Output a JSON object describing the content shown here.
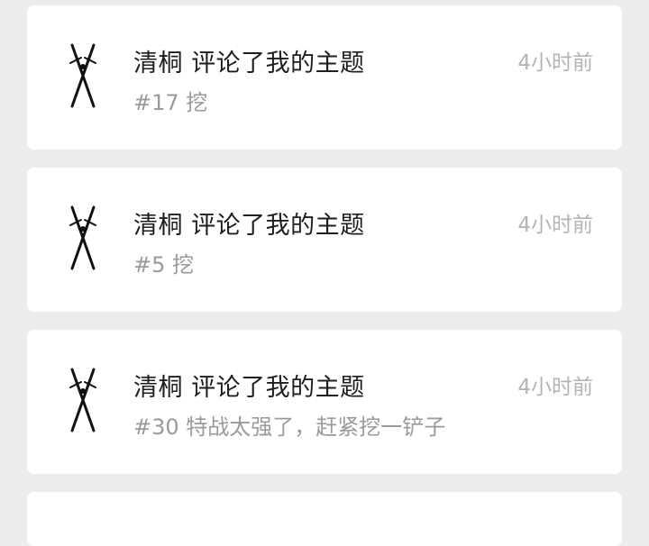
{
  "notifications": [
    {
      "user": "清桐",
      "action": "评论了我的主题",
      "snippet": "#17 挖",
      "time": "4小时前",
      "avatar_icon": "crossed-swords-icon"
    },
    {
      "user": "清桐",
      "action": "评论了我的主题",
      "snippet": "#5 挖",
      "time": "4小时前",
      "avatar_icon": "crossed-swords-icon"
    },
    {
      "user": "清桐",
      "action": "评论了我的主题",
      "snippet": "#30 特战太强了，赶紧挖一铲子",
      "time": "4小时前",
      "avatar_icon": "crossed-swords-icon"
    }
  ],
  "colors": {
    "background": "#ececec",
    "card": "#ffffff",
    "title": "#1e1e1e",
    "snippet": "#9a9a9a",
    "time": "#b4b4b4"
  }
}
